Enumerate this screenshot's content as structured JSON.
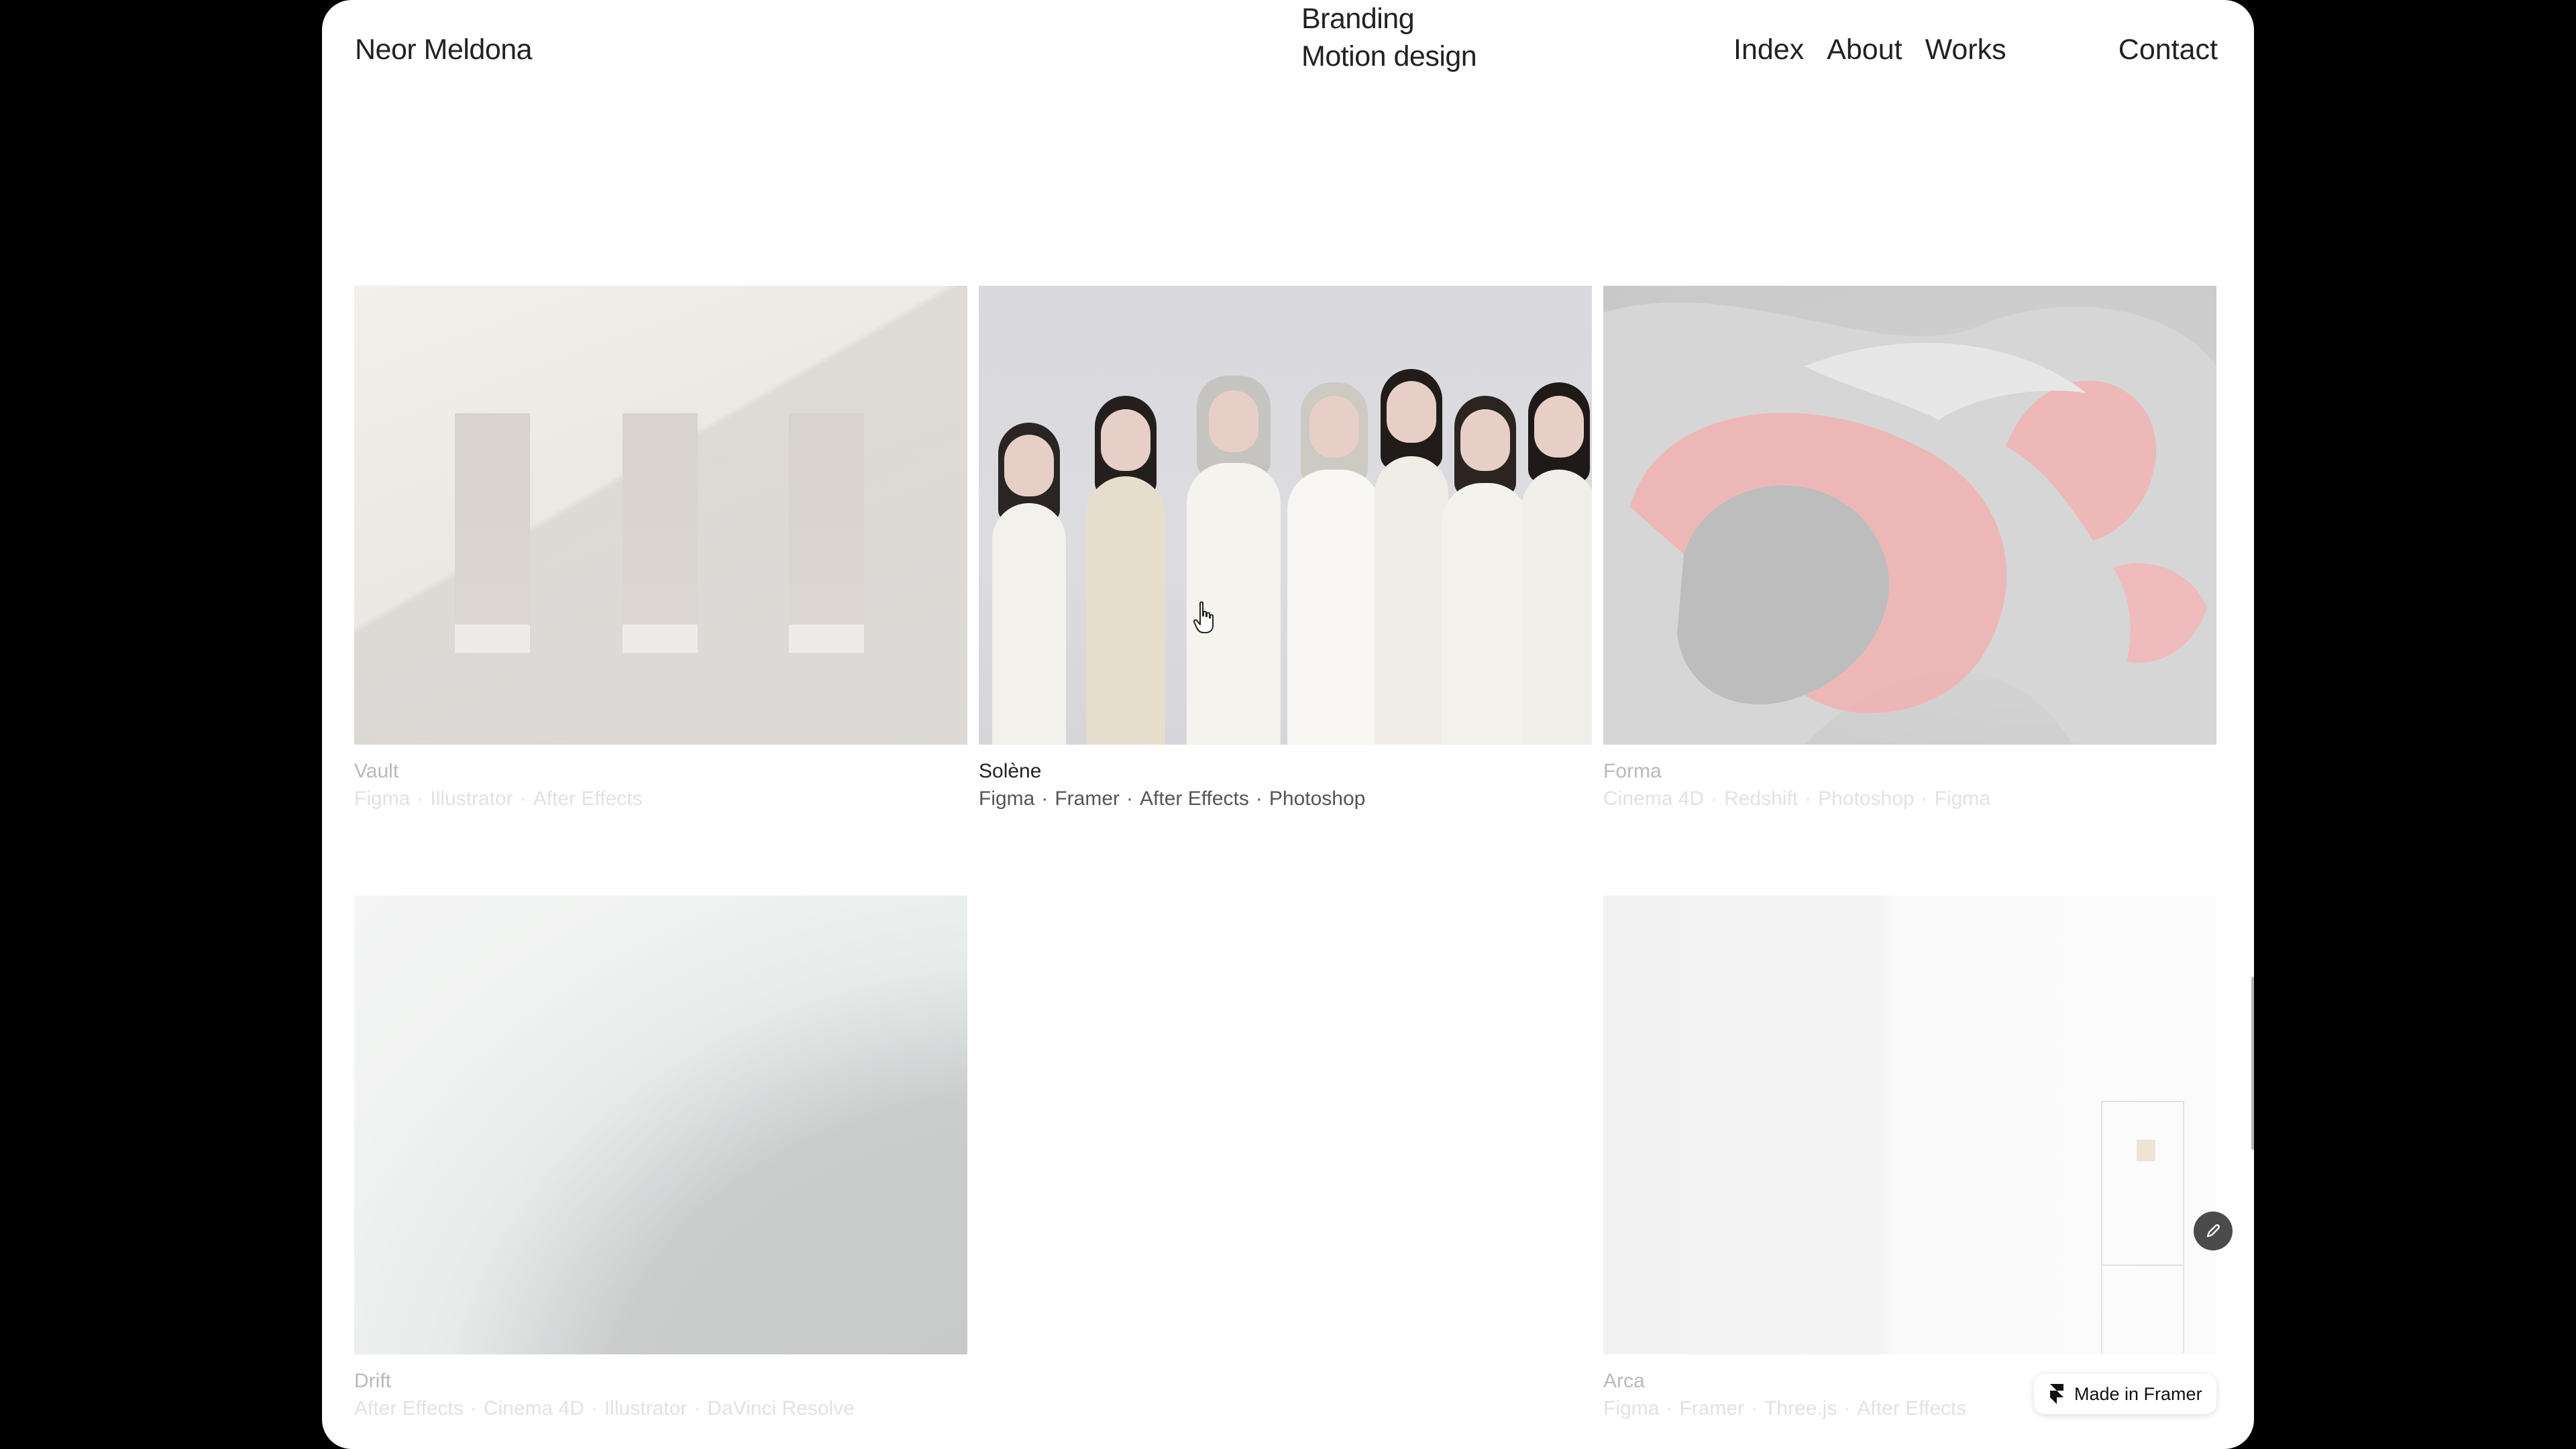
{
  "header": {
    "brand": "Neor Meldona",
    "services": [
      "Branding",
      "Motion design"
    ],
    "nav": [
      "Index",
      "About",
      "Works"
    ],
    "contact": "Contact"
  },
  "projects": [
    {
      "title": "Vault",
      "tags": [
        "Figma",
        "Illustrator",
        "After Effects"
      ],
      "state": "faded"
    },
    {
      "title": "Solène",
      "tags": [
        "Figma",
        "Framer",
        "After Effects",
        "Photoshop"
      ],
      "state": "active"
    },
    {
      "title": "Forma",
      "tags": [
        "Cinema 4D",
        "Redshift",
        "Photoshop",
        "Figma"
      ],
      "state": "faded"
    },
    {
      "title": "Drift",
      "tags": [
        "After Effects",
        "Cinema 4D",
        "Illustrator",
        "DaVinci Resolve"
      ],
      "state": "faded"
    },
    {
      "title": "Arca",
      "tags": [
        "Figma",
        "Framer",
        "Three.js",
        "After Effects"
      ],
      "state": "faded"
    }
  ],
  "tag_separator": "·",
  "badge": {
    "label": "Made in Framer",
    "icon": "framer-logo-icon"
  },
  "edit_button": {
    "icon": "pencil-icon"
  },
  "cursor": {
    "icon": "hand-pointer-icon"
  },
  "colors": {
    "background": "#000000",
    "page": "#ffffff",
    "text": "#222222",
    "faded_title": "#b9b9b9",
    "faded_tags": "#e2e2e2"
  }
}
